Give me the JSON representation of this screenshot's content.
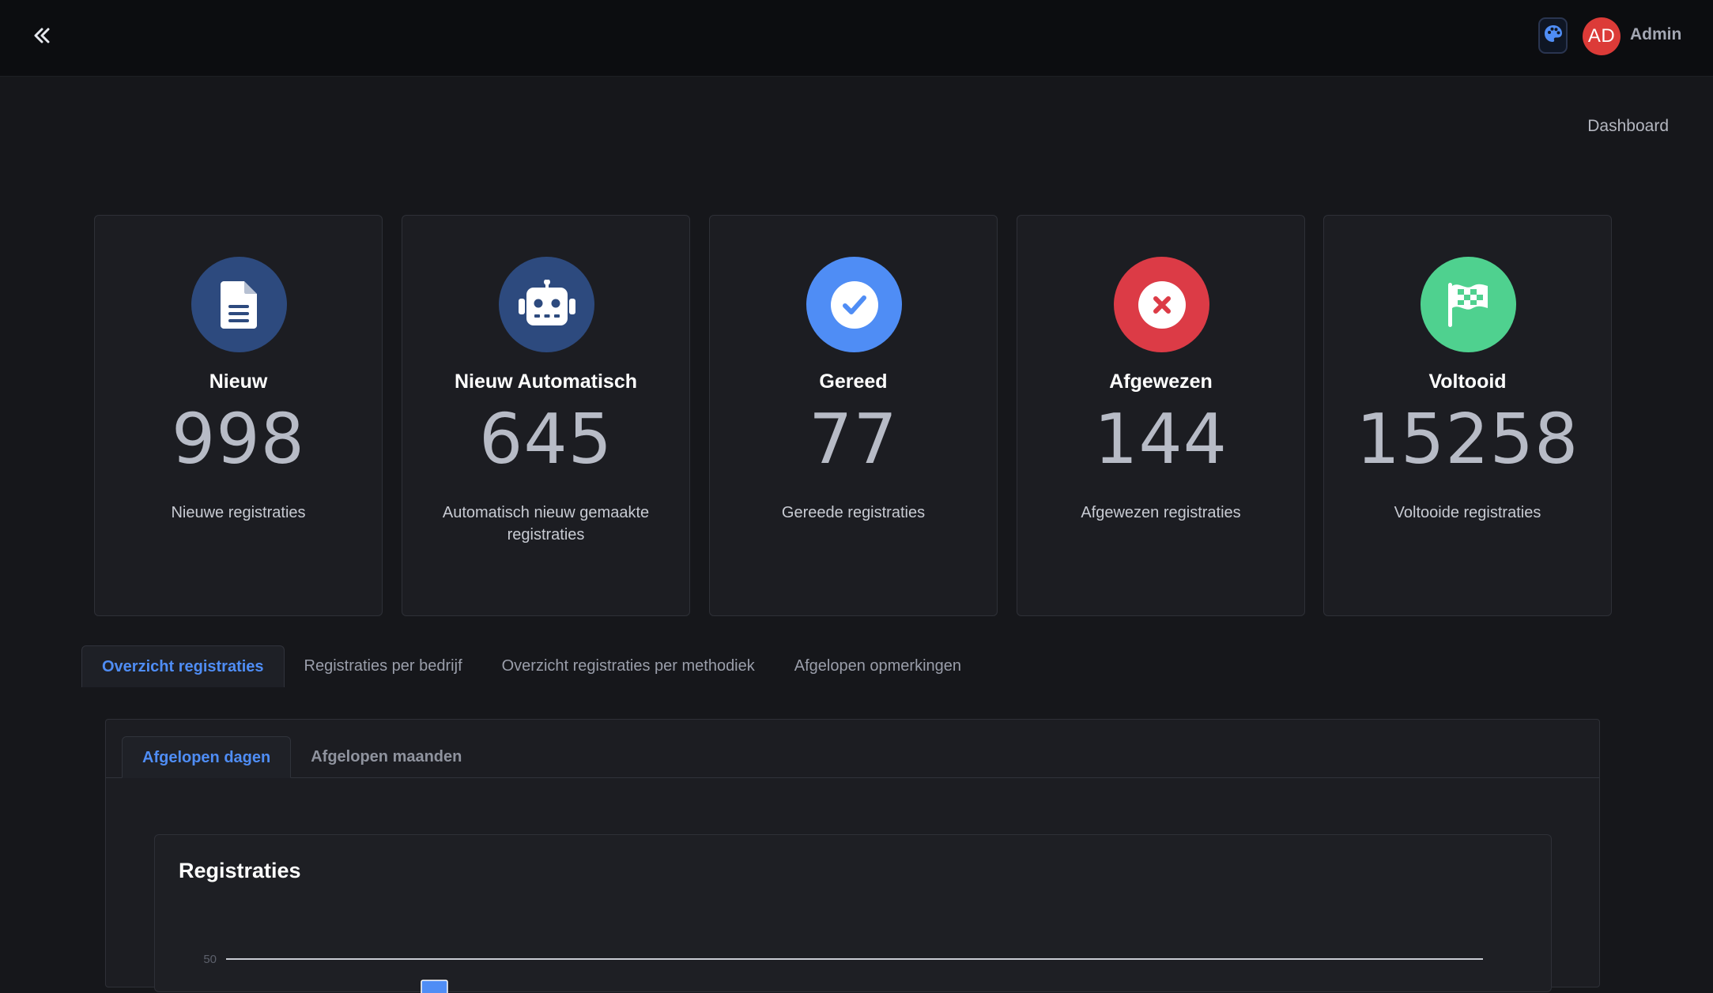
{
  "topbar": {
    "collapse_icon": "double-chevron-left-icon",
    "theme_icon": "palette-icon",
    "avatar_initials": "AD",
    "user_name": "Admin",
    "colors": {
      "avatar": "#dc3b38",
      "accent": "#4f8df5"
    }
  },
  "breadcrumb": "Dashboard",
  "cards": [
    {
      "icon": "file-icon",
      "color": "#2d4a7e",
      "title": "Nieuw",
      "value": "998",
      "desc": "Nieuwe registraties"
    },
    {
      "icon": "robot-icon",
      "color": "#2d4a7e",
      "title": "Nieuw Automatisch",
      "value": "645",
      "desc": "Automatisch nieuw gemaakte registraties"
    },
    {
      "icon": "check-circle-icon",
      "color": "#4f8df5",
      "title": "Gereed",
      "value": "77",
      "desc": "Gereede registraties"
    },
    {
      "icon": "x-circle-icon",
      "color": "#dc3b46",
      "title": "Afgewezen",
      "value": "144",
      "desc": "Afgewezen registraties"
    },
    {
      "icon": "checkered-flag-icon",
      "color": "#4fd18f",
      "title": "Voltooid",
      "value": "15258",
      "desc": "Voltooide registraties"
    }
  ],
  "main_tabs": [
    {
      "label": "Overzicht registraties",
      "active": true
    },
    {
      "label": "Registraties per bedrijf",
      "active": false
    },
    {
      "label": "Overzicht registraties per methodiek",
      "active": false
    },
    {
      "label": "Afgelopen opmerkingen",
      "active": false
    }
  ],
  "sub_tabs": [
    {
      "label": "Afgelopen dagen",
      "active": true
    },
    {
      "label": "Afgelopen maanden",
      "active": false
    }
  ],
  "chart": {
    "title": "Registraties"
  },
  "chart_data": {
    "type": "bar",
    "title": "Registraties",
    "xlabel": "",
    "ylabel": "",
    "yticks": [
      50
    ],
    "categories": [],
    "values": [],
    "series": [
      {
        "color": "#4f8df5"
      }
    ]
  }
}
